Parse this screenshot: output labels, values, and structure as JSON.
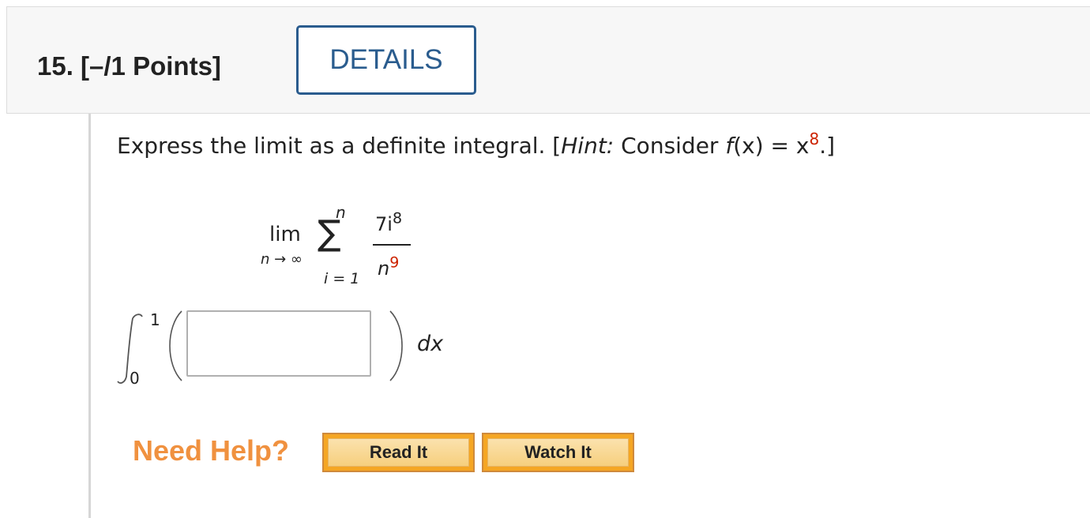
{
  "question": {
    "number_label": "15.",
    "points_label": "[–/1 Points]",
    "details_label": "DETAILS"
  },
  "prompt": {
    "text_before": "Express the limit as a definite integral. [",
    "hint_label": "Hint:",
    "text_consider": " Consider ",
    "f_symbol": "f",
    "f_arg": "(x) = x",
    "exponent": "8",
    "text_after": ".]"
  },
  "limit_expr": {
    "lim": "lim",
    "lim_sub": "n → ∞",
    "sum_upper": "n",
    "sum_lower": "i = 1",
    "numerator": "7i",
    "numerator_exp": "8",
    "denominator": "n",
    "denominator_exp": "9"
  },
  "integral": {
    "upper_bound": "1",
    "lower_bound": "0",
    "answer_value": "",
    "differential": "dx"
  },
  "help": {
    "label": "Need Help?",
    "read_it": "Read It",
    "watch_it": "Watch It"
  },
  "colors": {
    "accent_blue": "#2a5c8e",
    "exponent_red": "#cc2200",
    "help_orange": "#f0913f",
    "button_orange": "#f5a623"
  }
}
